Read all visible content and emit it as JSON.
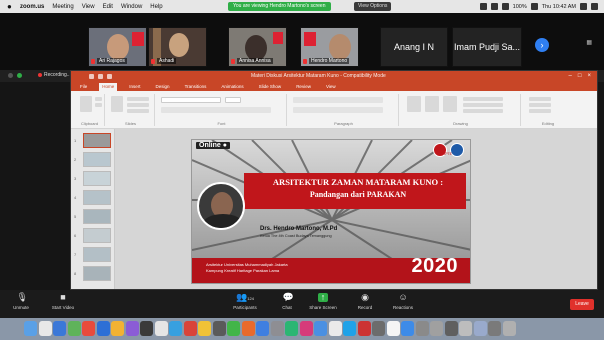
{
  "menubar": {
    "apple": "",
    "app_name": "zoom.us",
    "items": [
      "Meeting",
      "View",
      "Edit",
      "Window",
      "Help"
    ],
    "share_banner": "You are viewing Hendro Martono's screen",
    "view_options": "View Options",
    "clock": "Thu 10:42 AM",
    "battery": "100%"
  },
  "participants": [
    {
      "name": "Ari Rajagos"
    },
    {
      "name": "Ashadi"
    },
    {
      "name": "Annisa Annisa"
    },
    {
      "name": "Hendro Martono"
    }
  ],
  "name_tiles": [
    {
      "name": "Anang I N"
    },
    {
      "name": "Imam Pudji Sa..."
    }
  ],
  "recording_label": "Recording...",
  "ppt": {
    "window_title": "Materi Diskusi Arsitektur Mataram Kuno - Compatibility Mode",
    "tabs": [
      "File",
      "Home",
      "Insert",
      "Design",
      "Transitions",
      "Animations",
      "Slide Show",
      "Review",
      "View"
    ],
    "active_tab": "Home",
    "groups": [
      "Clipboard",
      "Slides",
      "Font",
      "Paragraph",
      "Drawing",
      "Editing"
    ],
    "thumb_count": 8
  },
  "slide": {
    "badge": "Online ●",
    "title": "ARSITEKTUR ZAMAN MATARAM KUNO :",
    "subtitle": "Pandangan dari PARAKAN",
    "speaker": "Drs. Hendro Martono, M.Pd",
    "speaker_role": "Ketua The 4th Coast Budaya Temanggung",
    "footer1": "Arsitektur Universitas Muhammadiyah Jakarta",
    "footer2": "Kampung Kreatif Haritage Parakan Lama",
    "year": "2020",
    "org_label": "IKAPTE"
  },
  "controls": [
    {
      "label": "Unmute",
      "icon": "microphone-muted-icon"
    },
    {
      "label": "Start Video",
      "icon": "video-off-icon"
    },
    {
      "label": "Participants",
      "count": "124",
      "icon": "participants-icon"
    },
    {
      "label": "Chat",
      "icon": "chat-icon"
    },
    {
      "label": "Share Screen",
      "icon": "share-screen-icon"
    },
    {
      "label": "Record",
      "icon": "record-icon"
    },
    {
      "label": "Reactions",
      "icon": "reactions-icon"
    }
  ],
  "leave_label": "Leave",
  "colors": {
    "ppt_accent": "#c84627",
    "slide_red": "#c0161b",
    "share_green": "#2fae47",
    "leave_red": "#e0312b",
    "next_blue": "#2f7ff2"
  }
}
